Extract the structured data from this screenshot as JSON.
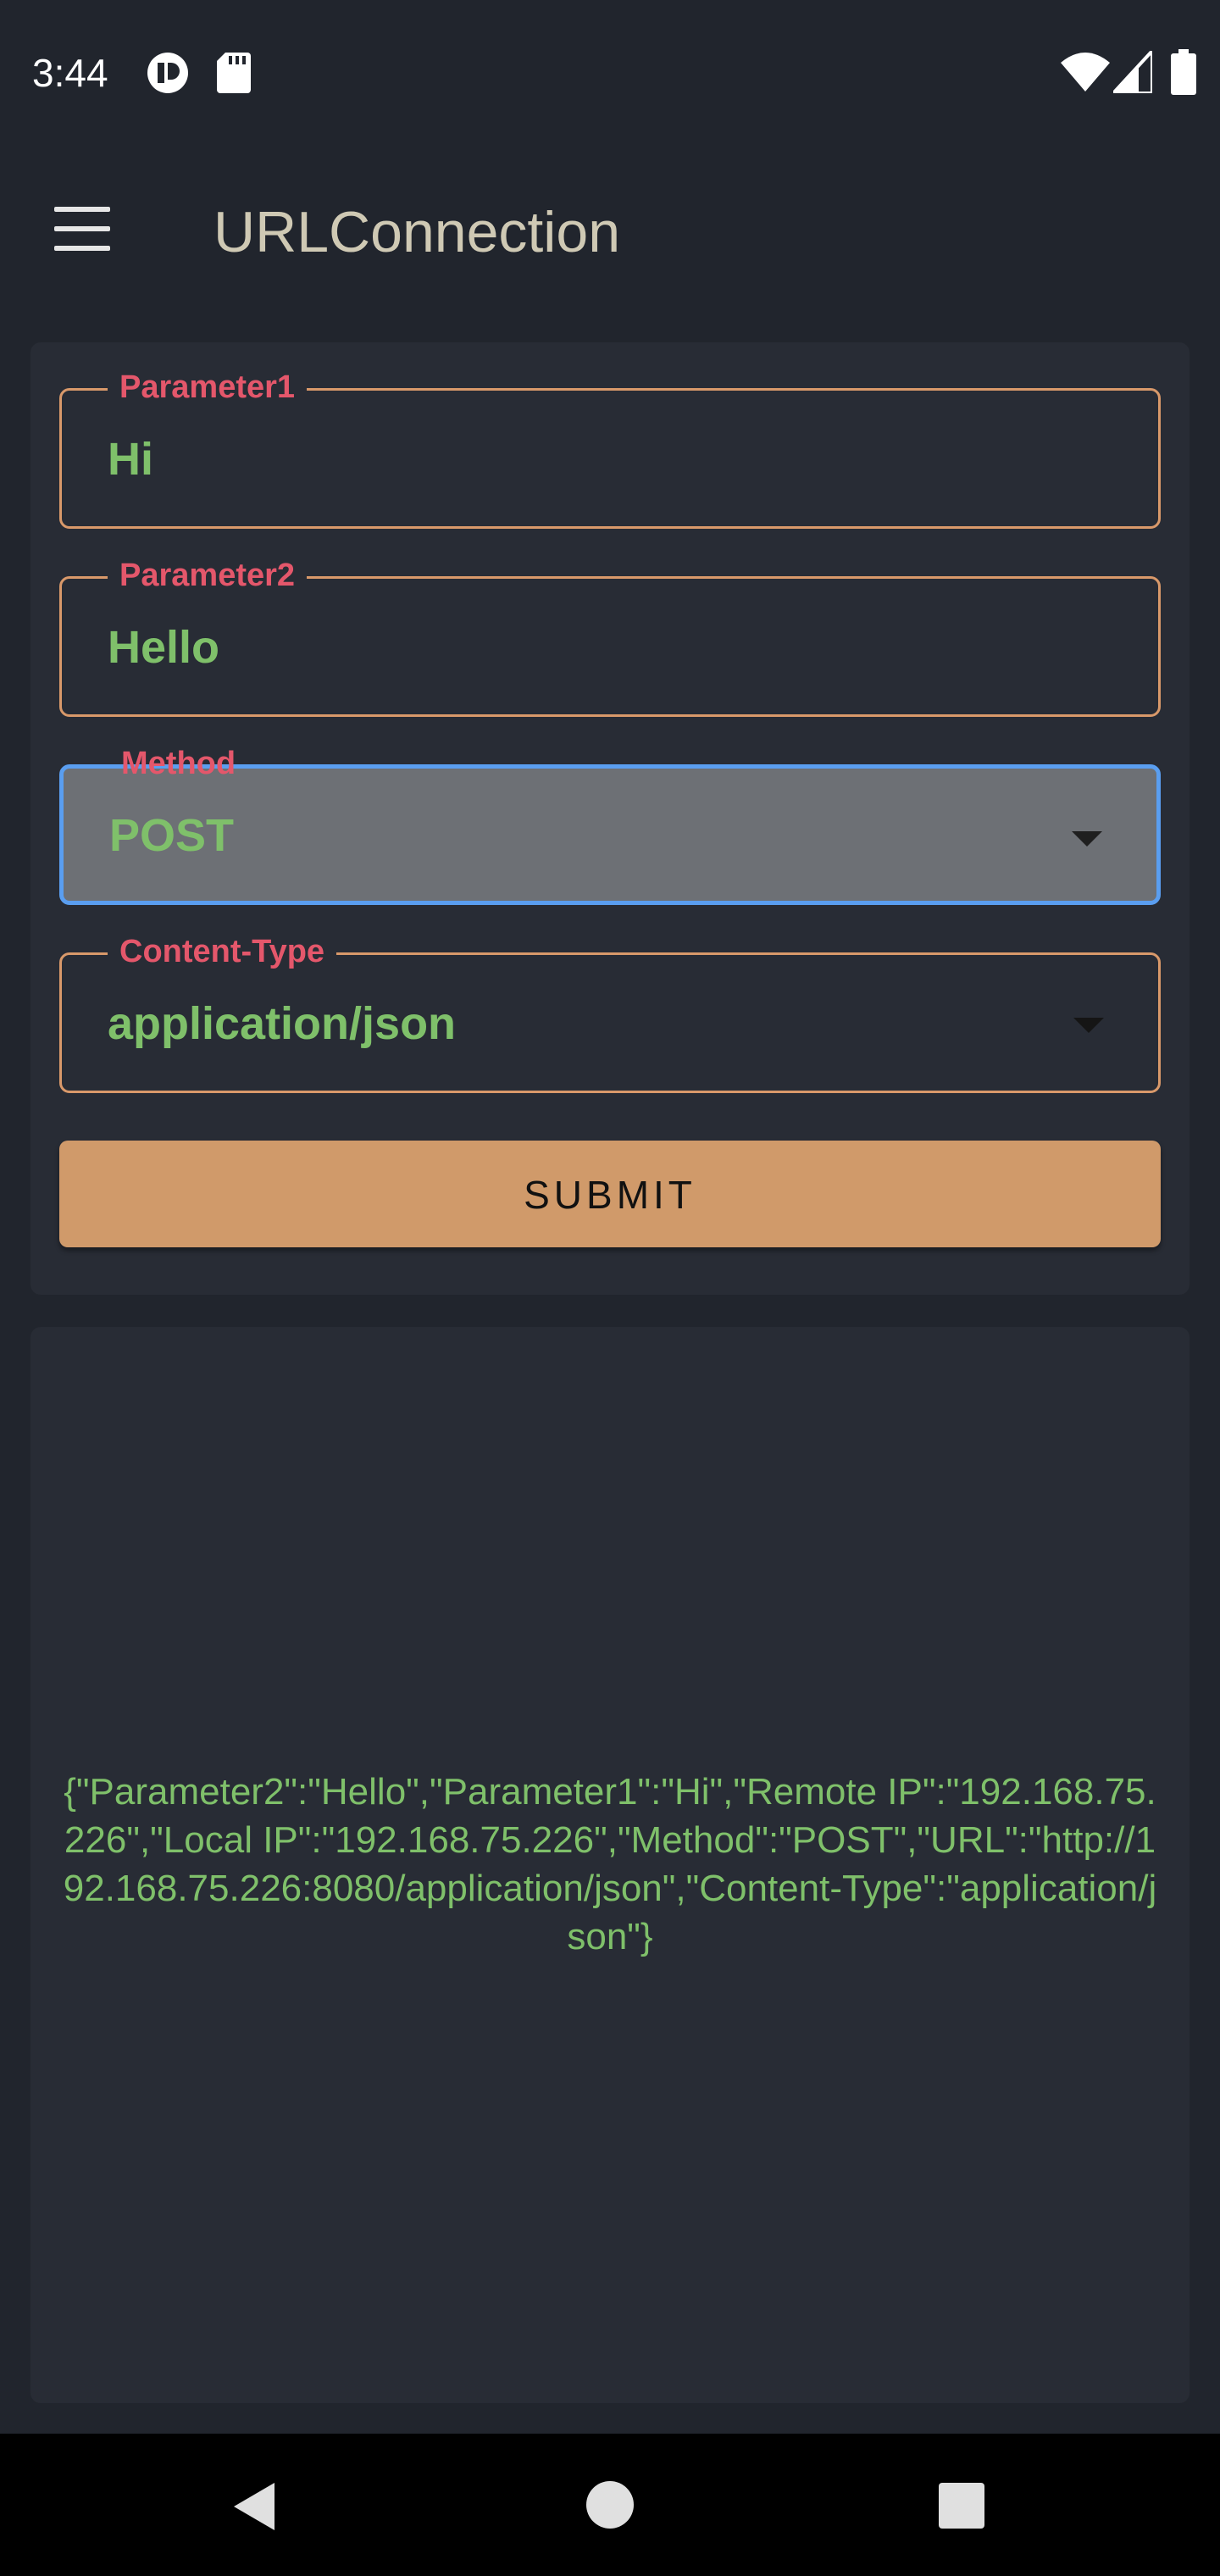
{
  "status_bar": {
    "time": "3:44",
    "left_icons": [
      "app-notification-icon",
      "sd-card-icon"
    ],
    "right_icons": [
      "wifi-icon",
      "cellular-signal-icon",
      "battery-icon"
    ]
  },
  "app_bar": {
    "title": "URLConnection",
    "menu_icon": "menu-icon"
  },
  "form": {
    "parameter1": {
      "label": "Parameter1",
      "value": "Hi"
    },
    "parameter2": {
      "label": "Parameter2",
      "value": "Hello"
    },
    "method": {
      "label": "Method",
      "value": "POST",
      "focused": true
    },
    "content_type": {
      "label": "Content-Type",
      "value": "application/json"
    },
    "submit_label": "SUBMIT"
  },
  "response": {
    "text": "{\"Parameter2\":\"Hello\",\"Parameter1\":\"Hi\",\"Remote IP\":\"192.168.75.226\",\"Local IP\":\"192.168.75.226\",\"Method\":\"POST\",\"URL\":\"http://192.168.75.226:8080/application/json\",\"Content-Type\":\"application/json\"}"
  },
  "colors": {
    "background": "#21252d",
    "card": "#282c35",
    "accent_border": "#d9996a",
    "focus_border": "#5a9ef0",
    "label": "#e4576b",
    "value": "#7fc06a",
    "button": "#d09a6a"
  },
  "nav_bar": {
    "buttons": [
      "back-icon",
      "home-icon",
      "recents-icon"
    ]
  }
}
